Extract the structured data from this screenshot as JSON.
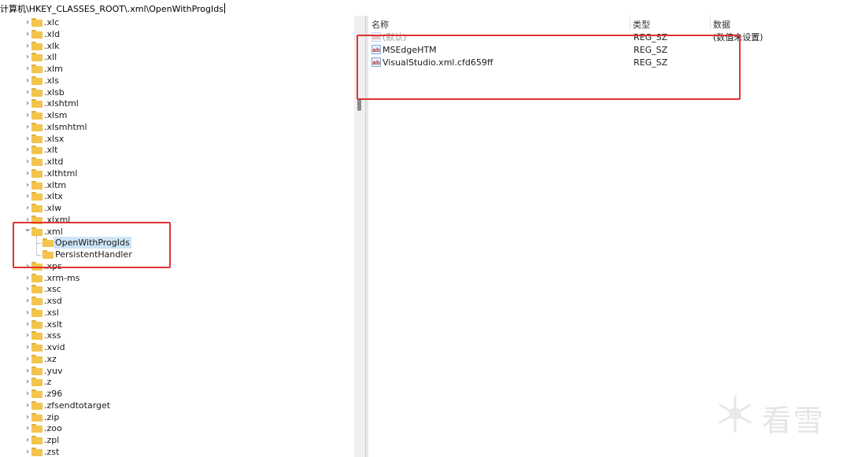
{
  "address": {
    "path": "计算机\\HKEY_CLASSES_ROOT\\.xml\\OpenWithProgIds"
  },
  "tree": {
    "items_before": [
      ".xlc",
      ".xld",
      ".xlk",
      ".xll",
      ".xlm",
      ".xls",
      ".xlsb",
      ".xlshtml",
      ".xlsm",
      ".xlsmhtml",
      ".xlsx",
      ".xlt",
      ".xltd",
      ".xlthtml",
      ".xltm",
      ".xltx",
      ".xlw",
      ".xlxml"
    ],
    "expanded_item": ".xml",
    "children": [
      "OpenWithProgIds",
      "PersistentHandler"
    ],
    "selected_child": "OpenWithProgIds",
    "items_after": [
      ".xps",
      ".xrm-ms",
      ".xsc",
      ".xsd",
      ".xsl",
      ".xslt",
      ".xss",
      ".xvid",
      ".xz",
      ".yuv",
      ".z",
      ".z96",
      ".zfsendtotarget",
      ".zip",
      ".zoo",
      ".zpl",
      ".zst"
    ]
  },
  "values": {
    "headers": {
      "name": "名称",
      "type": "类型",
      "data": "数据"
    },
    "rows": [
      {
        "name": "(默认)",
        "type": "REG_SZ",
        "data": "(数值未设置)",
        "icon": "string-value-icon",
        "dim": true
      },
      {
        "name": "MSEdgeHTM",
        "type": "REG_SZ",
        "data": "",
        "icon": "string-value-icon",
        "dim": false
      },
      {
        "name": "VisualStudio.xml.cfd659ff",
        "type": "REG_SZ",
        "data": "",
        "icon": "string-value-icon",
        "dim": false
      }
    ],
    "icon_glyph": "ab"
  },
  "watermark": {
    "text": "看雪"
  },
  "colors": {
    "highlight": "#e23232",
    "folder": "#f3c44e",
    "selection": "#cde5f7"
  }
}
